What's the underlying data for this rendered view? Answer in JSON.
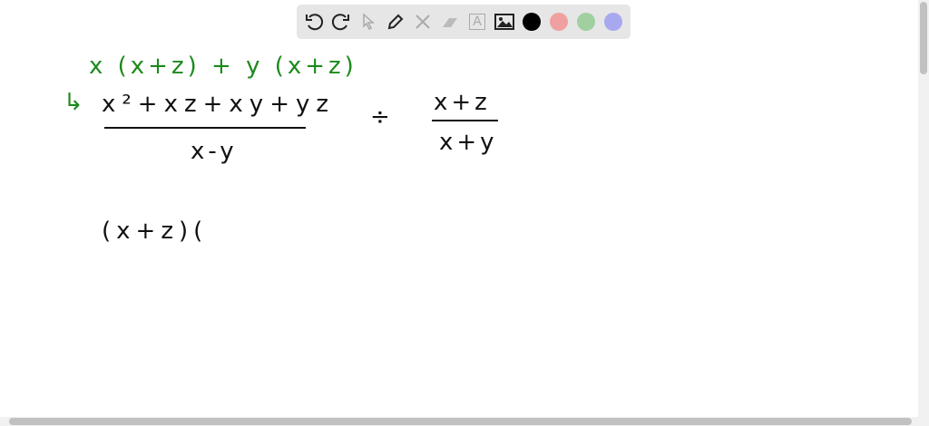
{
  "toolbar": {
    "tools": [
      "undo-icon",
      "redo-icon",
      "select-icon",
      "pen-icon",
      "tools-icon",
      "eraser-icon",
      "text-icon",
      "image-icon"
    ],
    "colors": [
      "#000000",
      "#f0a0a0",
      "#a0d0a0",
      "#a8a8f0"
    ],
    "text_tool_label": "A"
  },
  "canvas": {
    "green_line": "x (x+z) + y (x+z)",
    "arrow": "↳",
    "numerator": "x²+xz+xy+yz",
    "denominator": "x-y",
    "divide": "÷",
    "right_numerator": "x+z",
    "right_denominator": "x+y",
    "work_line": "(x+z)("
  },
  "colors": {
    "green": "#1c8a1c",
    "ink": "#111111"
  }
}
